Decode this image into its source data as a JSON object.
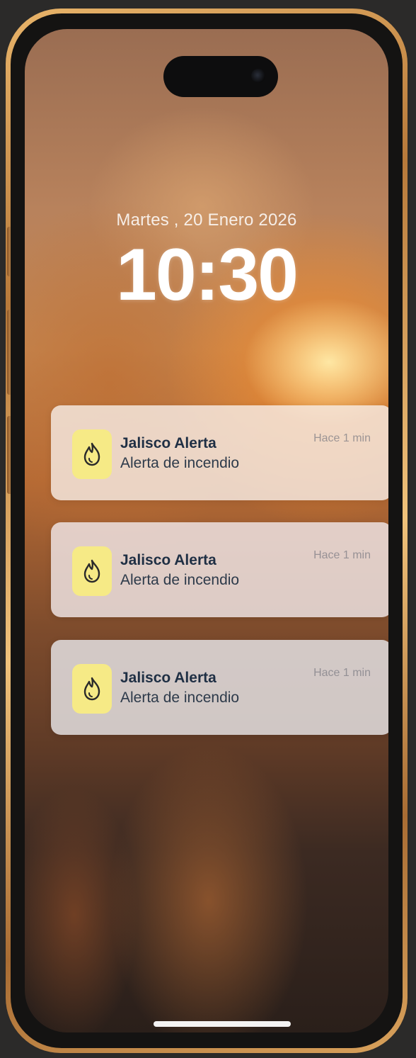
{
  "lock_screen": {
    "date": "Martes , 20 Enero 2026",
    "time": "10:30"
  },
  "notifications": [
    {
      "app": "Jalisco Alerta",
      "message": "Alerta de incendio",
      "ago": "Hace 1 min",
      "icon": "flame-icon"
    },
    {
      "app": "Jalisco Alerta",
      "message": "Alerta de incendio",
      "ago": "Hace 1 min",
      "icon": "flame-icon"
    },
    {
      "app": "Jalisco Alerta",
      "message": "Alerta de incendio",
      "ago": "Hace 1 min",
      "icon": "flame-icon"
    }
  ],
  "colors": {
    "frame": "#c98b45",
    "icon_background": "#f6ea86",
    "app_name_text": "#1f2f44"
  }
}
